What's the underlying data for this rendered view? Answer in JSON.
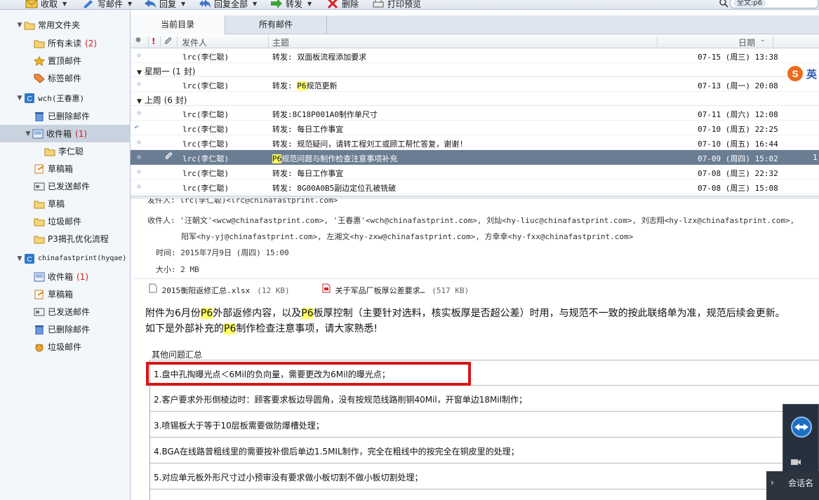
{
  "toolbar": {
    "receive": "收取",
    "write": "写邮件",
    "reply": "回复",
    "reply_all": "回复全部",
    "forward": "转发",
    "delete": "删除",
    "print_preview": "打印预览",
    "search_value": "全文:p6"
  },
  "sidebar": {
    "items": [
      {
        "label": "常用文件夹",
        "count": ""
      },
      {
        "label": "所有未读",
        "count": "(2)"
      },
      {
        "label": "置顶邮件",
        "count": ""
      },
      {
        "label": "标签邮件",
        "count": ""
      },
      {
        "label": "wch(王春惠)",
        "count": ""
      },
      {
        "label": "已删除邮件",
        "count": ""
      },
      {
        "label": "收件箱",
        "count": "(1)"
      },
      {
        "label": "李仁聪",
        "count": ""
      },
      {
        "label": "草稿箱",
        "count": ""
      },
      {
        "label": "已发送邮件",
        "count": ""
      },
      {
        "label": "草稿",
        "count": ""
      },
      {
        "label": "垃圾邮件",
        "count": ""
      },
      {
        "label": "P3揭孔优化流程",
        "count": ""
      },
      {
        "label": "chinafastprint(hyqae)",
        "count": ""
      },
      {
        "label": "收件箱",
        "count": "(1)"
      },
      {
        "label": "草稿箱",
        "count": ""
      },
      {
        "label": "已发送邮件",
        "count": ""
      },
      {
        "label": "已删除邮件",
        "count": ""
      },
      {
        "label": "垃圾邮件",
        "count": ""
      }
    ]
  },
  "tabs": [
    "当前目录",
    "所有邮件"
  ],
  "columns": {
    "sender": "发件人",
    "subject": "主题",
    "date": "日期"
  },
  "groups": [
    "星期一 (1 封)",
    "上周 (6 封)"
  ],
  "messages": [
    {
      "sender": "lrc(李仁聪)",
      "subject": "转发: 双面板流程添加要求",
      "date": "07-15 (周三) 13:38"
    },
    {
      "sender": "lrc(李仁聪)",
      "subject_pre": "转发: ",
      "subject_hl": "P6",
      "subject_post": "规范更新",
      "date": "07-13 (周一) 20:08"
    },
    {
      "sender": "lrc(李仁聪)",
      "subject": "转发:8C18P001A0制作单尺寸",
      "date": "07-11 (周六) 12:08"
    },
    {
      "sender": "lrc(李仁聪)",
      "subject": "转发: 每日工作事宜",
      "date": "07-10 (周五) 22:25"
    },
    {
      "sender": "lrc(李仁聪)",
      "subject": "转发: 规范疑问，请转工程刘工或顾工帮忙答复，谢谢!",
      "date": "07-10 (周五) 16:44"
    },
    {
      "sender": "lrc(李仁聪)",
      "subject_hl": "P6",
      "subject_post": "规范问题与制作检查注意事项补充",
      "date": "07-09 (周四) 15:02",
      "extra": "1,"
    },
    {
      "sender": "lrc(李仁聪)",
      "subject": "转发:   每日工作事宜",
      "date": "07-08 (周三) 22:32"
    },
    {
      "sender": "lrc(李仁聪)",
      "subject": "转发: 8G00A0B5副边定位孔被铣破",
      "date": "07-08 (周三) 15:08"
    }
  ],
  "reading": {
    "from_line": "发件人: lrc(李仁聪)<lrc@chinafastprint.com>",
    "to_label": "收件人:",
    "to_line1": "'汪朝文'<wcw@chinafastprint.com>, '王春惠'<wch@chinafastprint.com>,  刘灿<hy-liuc@chinafastprint.com>,  刘志翔<hy-lzx@chinafastprint.com>,",
    "to_line2": "阳军<hy-yj@chinafastprint.com>,  左湘文<hy-zxw@chinafastprint.com>,  方幸幸<hy-fxx@chinafastprint.com>",
    "time_label": "时间:",
    "time_value": "2015年7月9日 (周四) 15:00",
    "size_label": "大小:",
    "size_value": "2 MB",
    "attachments": [
      {
        "name": "2015衡阳返修汇总.xlsx",
        "size": "(12 KB)"
      },
      {
        "name": "关于军品厂板厚公差要求…",
        "size": "(517 KB)"
      }
    ],
    "para1_a": "附件为6月份",
    "para1_b": "外部返修内容，以及",
    "para1_c": "板厚控制（主要针对选料，核实板厚是否超公差）时用，与规范不一致的按此联络单为准，规范后续会更新。",
    "para2_a": "如下是外部补充的",
    "para2_b": "制作检查注意事项，请大家熟悉!",
    "hl": "P6",
    "table_caption": "其他问题汇总",
    "table_rows": [
      "1.盘中孔掏曝光点＜6Mil的负向量，需要更改为6Mil的曝光点；",
      "2.客户要求外形倒棱边时：顾客要求板边导圆角，没有按规范线路削铜40Mil，开窗单边18Mil制作；",
      "3.喷锡板大于等于10层板需要做防爆槽处理；",
      "4.BGA在线路曾粗线里的需要按补偿后单边1.5MIL制作，完全在粗线中的按完全在铜皮里的处理；",
      "5.对应单元板外形尺寸过小预审没有要求做小板切割不做小板切割处理；"
    ]
  },
  "overlay": {
    "ime_label": "英",
    "session_label": "会话名"
  },
  "colors": {
    "selected_row": "#6b7d93",
    "highlight": "#ffff66",
    "annotation": "#d41616",
    "unread_count": "#d41b1b"
  }
}
